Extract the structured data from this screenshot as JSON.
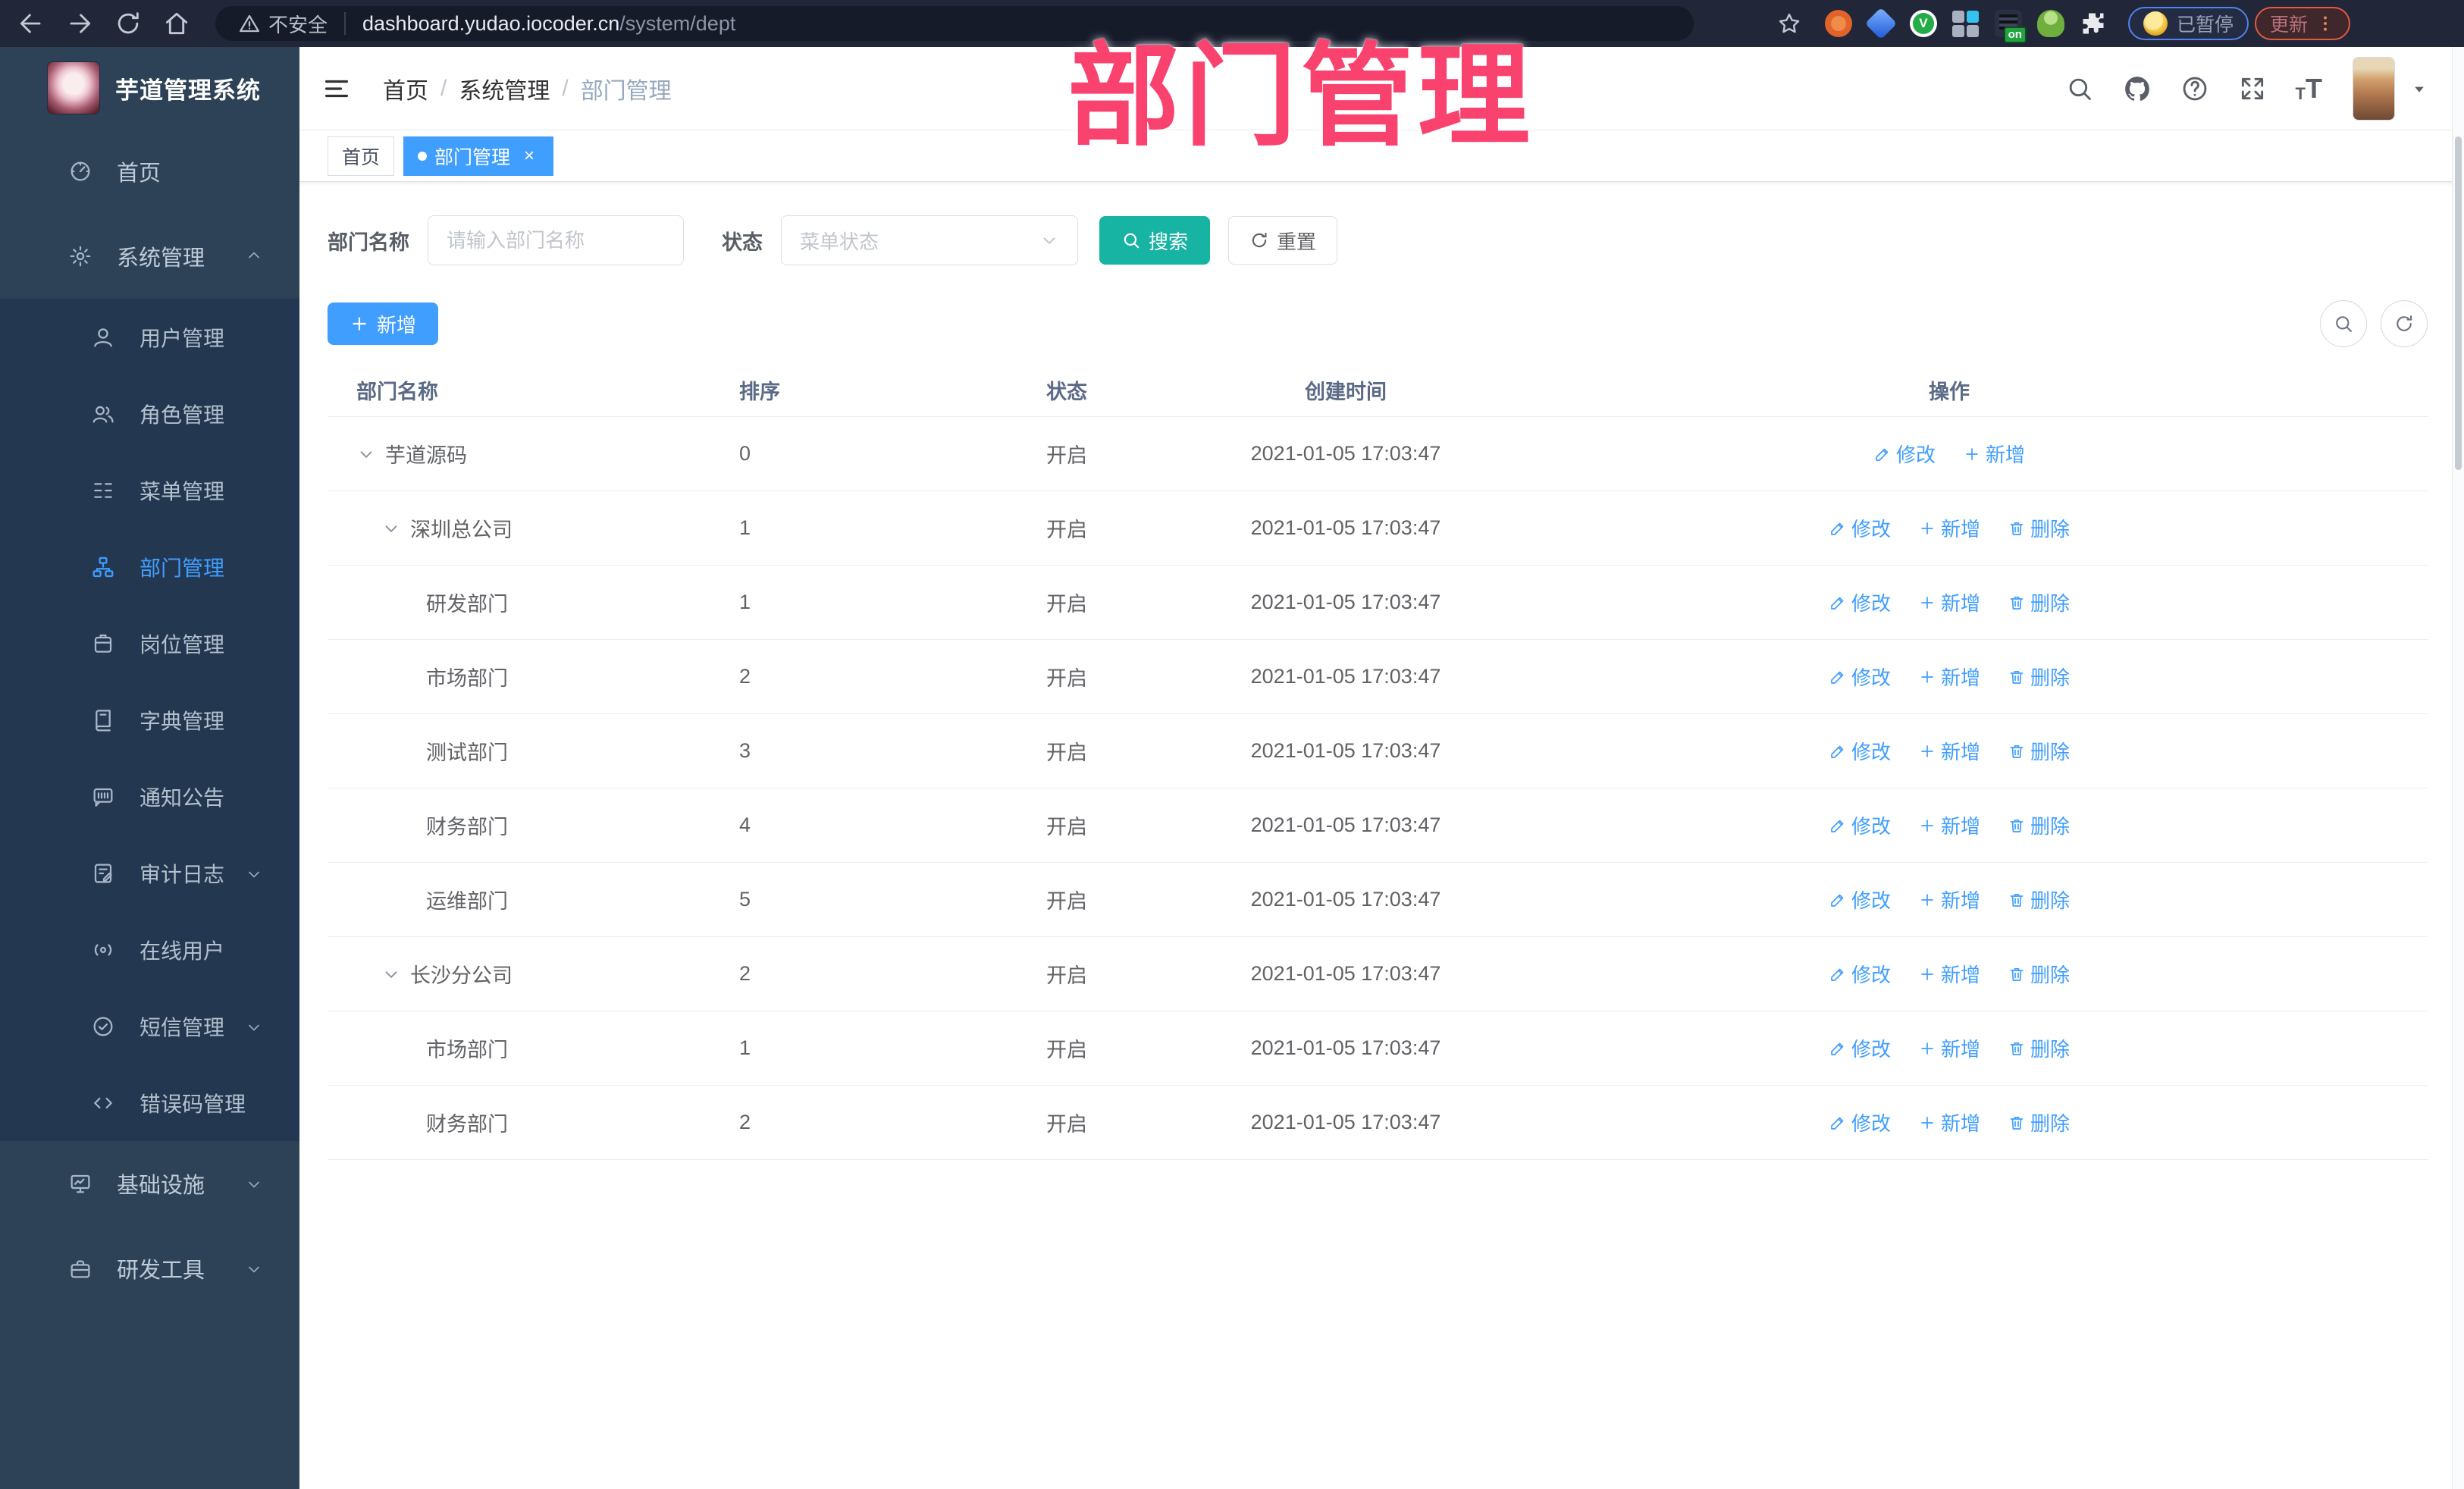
{
  "browser": {
    "insecure_label": "不安全",
    "url_host": "dashboard.yudao.iocoder.cn",
    "url_path": "/system/dept",
    "extension_badge": "on",
    "profile_status": "已暂停",
    "update_label": "更新"
  },
  "watermark": "部门管理",
  "sidebar": {
    "app_title": "芋道管理系统",
    "items": [
      {
        "label": "首页",
        "icon": "dashboard-icon",
        "level": 0
      },
      {
        "label": "系统管理",
        "icon": "gear-icon",
        "level": 0,
        "arrow": "up"
      },
      {
        "label": "用户管理",
        "icon": "user-icon",
        "level": 1
      },
      {
        "label": "角色管理",
        "icon": "users-icon",
        "level": 1
      },
      {
        "label": "菜单管理",
        "icon": "menu-tree-icon",
        "level": 1
      },
      {
        "label": "部门管理",
        "icon": "org-chart-icon",
        "level": 1,
        "active": true
      },
      {
        "label": "岗位管理",
        "icon": "badge-icon",
        "level": 1
      },
      {
        "label": "字典管理",
        "icon": "dictionary-icon",
        "level": 1
      },
      {
        "label": "通知公告",
        "icon": "announcement-icon",
        "level": 1
      },
      {
        "label": "审计日志",
        "icon": "audit-log-icon",
        "level": 1,
        "arrow": "down"
      },
      {
        "label": "在线用户",
        "icon": "online-user-icon",
        "level": 1
      },
      {
        "label": "短信管理",
        "icon": "sms-icon",
        "level": 1,
        "arrow": "down"
      },
      {
        "label": "错误码管理",
        "icon": "error-code-icon",
        "level": 1
      },
      {
        "label": "基础设施",
        "icon": "infrastructure-icon",
        "level": 0,
        "arrow": "down"
      },
      {
        "label": "研发工具",
        "icon": "dev-tools-icon",
        "level": 0,
        "arrow": "down"
      }
    ]
  },
  "navbar": {
    "breadcrumb": [
      "首页",
      "系统管理",
      "部门管理"
    ],
    "separator": "/"
  },
  "tags": [
    {
      "label": "首页",
      "active": false,
      "closable": false
    },
    {
      "label": "部门管理",
      "active": true,
      "closable": true
    }
  ],
  "filter": {
    "name_label": "部门名称",
    "name_placeholder": "请输入部门名称",
    "status_label": "状态",
    "status_placeholder": "菜单状态",
    "search_label": "搜索",
    "reset_label": "重置"
  },
  "actions_bar": {
    "add_label": "新增"
  },
  "table": {
    "columns": [
      "部门名称",
      "排序",
      "状态",
      "创建时间",
      "操作"
    ],
    "rows": [
      {
        "name": "芋道源码",
        "level": 0,
        "expandable": true,
        "sort": "0",
        "status": "开启",
        "created": "2021-01-05 17:03:47",
        "actions": [
          "修改",
          "新增"
        ]
      },
      {
        "name": "深圳总公司",
        "level": 1,
        "expandable": true,
        "sort": "1",
        "status": "开启",
        "created": "2021-01-05 17:03:47",
        "actions": [
          "修改",
          "新增",
          "删除"
        ]
      },
      {
        "name": "研发部门",
        "level": 2,
        "expandable": false,
        "sort": "1",
        "status": "开启",
        "created": "2021-01-05 17:03:47",
        "actions": [
          "修改",
          "新增",
          "删除"
        ]
      },
      {
        "name": "市场部门",
        "level": 2,
        "expandable": false,
        "sort": "2",
        "status": "开启",
        "created": "2021-01-05 17:03:47",
        "actions": [
          "修改",
          "新增",
          "删除"
        ]
      },
      {
        "name": "测试部门",
        "level": 2,
        "expandable": false,
        "sort": "3",
        "status": "开启",
        "created": "2021-01-05 17:03:47",
        "actions": [
          "修改",
          "新增",
          "删除"
        ]
      },
      {
        "name": "财务部门",
        "level": 2,
        "expandable": false,
        "sort": "4",
        "status": "开启",
        "created": "2021-01-05 17:03:47",
        "actions": [
          "修改",
          "新增",
          "删除"
        ]
      },
      {
        "name": "运维部门",
        "level": 2,
        "expandable": false,
        "sort": "5",
        "status": "开启",
        "created": "2021-01-05 17:03:47",
        "actions": [
          "修改",
          "新增",
          "删除"
        ]
      },
      {
        "name": "长沙分公司",
        "level": 1,
        "expandable": true,
        "sort": "2",
        "status": "开启",
        "created": "2021-01-05 17:03:47",
        "actions": [
          "修改",
          "新增",
          "删除"
        ]
      },
      {
        "name": "市场部门",
        "level": 2,
        "expandable": false,
        "sort": "1",
        "status": "开启",
        "created": "2021-01-05 17:03:47",
        "actions": [
          "修改",
          "新增",
          "删除"
        ]
      },
      {
        "name": "财务部门",
        "level": 2,
        "expandable": false,
        "sort": "2",
        "status": "开启",
        "created": "2021-01-05 17:03:47",
        "actions": [
          "修改",
          "新增",
          "删除"
        ]
      }
    ]
  },
  "colors": {
    "primary": "#409eff",
    "search_button": "#17b3a3",
    "watermark": "#f9426e",
    "sidebar_bg": "#2d4257",
    "submenu_bg": "#233750"
  }
}
